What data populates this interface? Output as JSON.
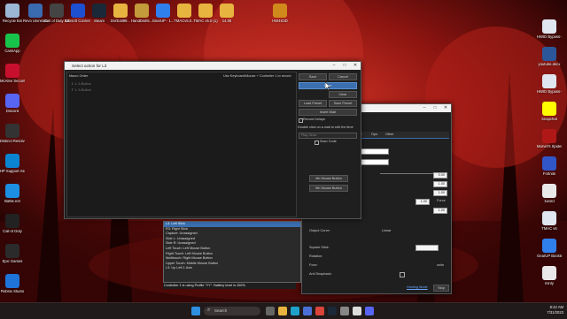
{
  "desktop_left": [
    {
      "label": "Recycle Bin",
      "icon": "recycle-bin-icon",
      "color": "#9bb7d4"
    },
    {
      "label": "CashApp",
      "icon": "cashapp-icon",
      "color": "#18c34b"
    },
    {
      "label": "McAfee Security Sc...",
      "icon": "mcafee-icon",
      "color": "#c8102e"
    },
    {
      "label": "Discord",
      "icon": "discord-icon",
      "color": "#5865f2"
    },
    {
      "label": "Distinct Resolve",
      "icon": "resolve-icon",
      "color": "#333333"
    },
    {
      "label": "HP Support Assistant",
      "icon": "hp-icon",
      "color": "#0a84d0"
    },
    {
      "label": "Battle.net",
      "icon": "battlenet-icon",
      "color": "#1c8fe2"
    },
    {
      "label": "Call of Duty",
      "icon": "call-of-duty-icon",
      "color": "#222222"
    },
    {
      "label": "Epic Games",
      "icon": "epic-games-icon",
      "color": "#2b2b2b"
    },
    {
      "label": "Roblox Studio",
      "icon": "roblox-icon",
      "color": "#1e74d8"
    }
  ],
  "desktop_top": [
    {
      "label": "Revo Uninstaller",
      "icon": "revo-icon",
      "color": "#3a6ab0"
    },
    {
      "label": "Call of Duty Black Ops III",
      "icon": "cod-bo3-icon",
      "color": "#444444"
    },
    {
      "label": "Ubisoft Connect",
      "icon": "ubisoft-icon",
      "color": "#1d4fd1"
    },
    {
      "label": "Steam",
      "icon": "steam-icon",
      "color": "#1b2838"
    },
    {
      "label": "DvrEdit98...",
      "icon": "folder-icon",
      "color": "#e8b440"
    },
    {
      "label": "HandDish5...",
      "icon": "x-app-icon",
      "color": "#c39b3a"
    },
    {
      "label": "GearUP - 1...",
      "icon": "gearup-icon",
      "color": "#2f80ed"
    },
    {
      "label": "TMACv5.0...",
      "icon": "folder-icon",
      "color": "#e8b440"
    },
    {
      "label": "TMAC v5.0 (1)",
      "icon": "folder-icon",
      "color": "#e8b440"
    },
    {
      "label": "14.00",
      "icon": "folder-icon",
      "color": "#e8b440"
    },
    {
      "label": "HW4X3D",
      "icon": "hw-icon",
      "color": "#d08a1c"
    }
  ],
  "desktop_right": [
    {
      "label": "HWID Bypass-202...",
      "icon": "hwid-icon",
      "color": "#dfe6f0"
    },
    {
      "label": "youtube.docx",
      "icon": "docx-icon",
      "color": "#2b579a"
    },
    {
      "label": "HWID Bypass-202...",
      "icon": "hwid-icon",
      "color": "#dfe6f0"
    },
    {
      "label": "Snapchat",
      "icon": "snapchat-icon",
      "color": "#fffc00"
    },
    {
      "label": "Marvel's Spider-M...",
      "icon": "spiderman-icon",
      "color": "#b01818"
    },
    {
      "label": "Fortnite",
      "icon": "fortnite-icon",
      "color": "#3056c8"
    },
    {
      "label": "1word",
      "icon": "file-icon",
      "color": "#e9e9e9"
    },
    {
      "label": "TMAC v6",
      "icon": "tmac-icon",
      "color": "#dfe6f0"
    },
    {
      "label": "GearUP Booster",
      "icon": "gearup-icon",
      "color": "#2f80ed"
    },
    {
      "label": "minty",
      "icon": "file-icon",
      "color": "#e9e9e9"
    }
  ],
  "macro_window": {
    "title": "Select action for L3",
    "order_label": "Macro Order",
    "instruction": "Use Keyboard/Mouse + Controller 1 to record",
    "entries": [
      "1: 4-Button",
      "1: 5-Button"
    ],
    "buttons": {
      "save": "Save",
      "cancel": "Cancel",
      "stop": "Stop",
      "clear": "Clear",
      "load_preset": "Load Preset",
      "save_preset": "Save Preset",
      "insert_wait": "Insert Wait"
    },
    "record_delays": "Record Delays",
    "hint": "Double click on a wait to edit the time",
    "play_mode": "Play Once",
    "scan_code": "Scan Code",
    "mouse4": "4th Mouse Button",
    "mouse5": "5th Mouse Button"
  },
  "back_window": {
    "tabs": [
      "...ped",
      "Ops",
      "Other"
    ],
    "values": [
      "0.00",
      "1.00",
      "1.00",
      "1.00",
      "1.00"
    ],
    "force_label": "Force",
    "sensitivity_label": "Sensitivity:",
    "output_curve_label": "Output Curve:",
    "output_curve_value": "Linear",
    "square_stick": "Square Stick:",
    "rotation": "Rotation:",
    "fove": "Fove:",
    "anti_snapback": "Anti Snapback:",
    "units": "units",
    "status": "Controller 1 is using Profile \"YY\". Battery level is 100%",
    "link": "Hunting Mode",
    "stop_btn": "Stop"
  },
  "dropdown_list": {
    "items": [
      "L3: Left Stick",
      "R3: Right Stick",
      "Capture: Unassigned",
      "Side L: Unassigned",
      "Side R: Unassigned",
      "Left Touch: Left Mouse Button",
      "Right Touch: Left Mouse Button",
      "Multitouch: Right Mouse Button",
      "Upper Touch: Middle Mouse Button",
      "L3: Up Left 1 Axis"
    ],
    "selected": 0
  },
  "taskbar": {
    "search_placeholder": "Search",
    "time": "8:42 AM",
    "date": "7/31/2023"
  }
}
